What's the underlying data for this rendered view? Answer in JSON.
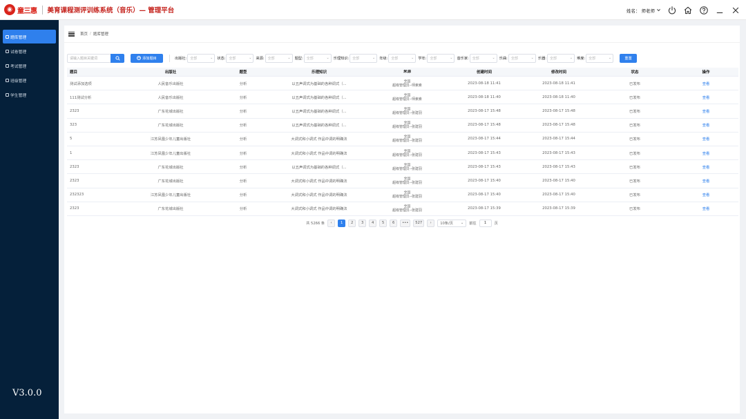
{
  "header": {
    "logo_text": "童三惠",
    "title": "美育课程测评训练系统（音乐）— 管理平台",
    "user_label": "姓名：",
    "user_name": "师老师",
    "icons": [
      "power-icon",
      "home-icon",
      "help-icon",
      "minimize-icon",
      "close-icon"
    ]
  },
  "sidebar": {
    "items": [
      {
        "label": "题库管理",
        "active": true
      },
      {
        "label": "试卷管理",
        "active": false
      },
      {
        "label": "考试管理",
        "active": false
      },
      {
        "label": "班级管理",
        "active": false
      },
      {
        "label": "学生管理",
        "active": false
      }
    ],
    "version": "V3.0.0"
  },
  "breadcrumb": {
    "home": "首页",
    "sep": "/",
    "current": "题库管理"
  },
  "toolbar": {
    "search_placeholder": "请输入题目关键词",
    "add_label": "添加题目",
    "reset_label": "重置",
    "filters": [
      {
        "label": "出版社:",
        "value": "全部"
      },
      {
        "label": "状态:",
        "value": "全部"
      },
      {
        "label": "来源:",
        "value": "全部"
      },
      {
        "label": "题型:",
        "value": "全部"
      },
      {
        "label": "乐理知识:",
        "value": "全部"
      },
      {
        "label": "年级:",
        "value": "全部"
      },
      {
        "label": "学年:",
        "value": "全部"
      },
      {
        "label": "音乐家:",
        "value": "全部"
      },
      {
        "label": "乐曲:",
        "value": "全部"
      },
      {
        "label": "乐器:",
        "value": "全部"
      },
      {
        "label": "难度:",
        "value": "全部"
      }
    ]
  },
  "table": {
    "headers": [
      "题目",
      "出版社",
      "题型",
      "乐理知识",
      "来源",
      "创建时间",
      "修改时间",
      "状态",
      "操作"
    ],
    "rows": [
      {
        "title": "测试添加选项",
        "publisher": "人民音乐出版社",
        "type": "分析",
        "knowledge": "以五声调式为基础的各种调式（...",
        "source1": "全国",
        "source2": "超级管理员--师索索",
        "created": "2023-08-18 11:41",
        "modified": "2023-08-18 11:41",
        "status": "已发布",
        "action": "查看"
      },
      {
        "title": "111测试分析",
        "publisher": "人民音乐出版社",
        "type": "分析",
        "knowledge": "以五声调式为基础的各种调式（...",
        "source1": "全国",
        "source2": "超级管理员--师索索",
        "created": "2023-08-18 11:40",
        "modified": "2023-08-18 11:40",
        "status": "已发布",
        "action": "查看"
      },
      {
        "title": "2323",
        "publisher": "广东花城出版社",
        "type": "分析",
        "knowledge": "以五声调式为基础的各种调式（...",
        "source1": "全国",
        "source2": "超级管理员--张建羽",
        "created": "2023-08-17 15:48",
        "modified": "2023-08-17 15:48",
        "status": "已发布",
        "action": "查看"
      },
      {
        "title": "323",
        "publisher": "广东花城出版社",
        "type": "分析",
        "knowledge": "以五声调式为基础的各种调式（...",
        "source1": "全国",
        "source2": "超级管理员--张建羽",
        "created": "2023-08-17 15:48",
        "modified": "2023-08-17 15:48",
        "status": "已发布",
        "action": "查看"
      },
      {
        "title": "5",
        "publisher": "江苏凤凰少年儿童出版社",
        "type": "分析",
        "knowledge": "大调式和小调式 作品中调的明确法",
        "source1": "全国",
        "source2": "超级管理员--张建羽",
        "created": "2023-08-17 15:44",
        "modified": "2023-08-17 15:44",
        "status": "已发布",
        "action": "查看"
      },
      {
        "title": "1",
        "publisher": "江苏凤凰少年儿童出版社",
        "type": "分析",
        "knowledge": "大调式和小调式 作品中调的明确法",
        "source1": "全国",
        "source2": "超级管理员--张建羽",
        "created": "2023-08-17 15:43",
        "modified": "2023-08-17 15:43",
        "status": "已发布",
        "action": "查看"
      },
      {
        "title": "2323",
        "publisher": "广东花城出版社",
        "type": "分析",
        "knowledge": "以五声调式为基础的各种调式（...",
        "source1": "全国",
        "source2": "超级管理员--张建羽",
        "created": "2023-08-17 15:43",
        "modified": "2023-08-17 15:43",
        "status": "已发布",
        "action": "查看"
      },
      {
        "title": "2323",
        "publisher": "广东花城出版社",
        "type": "分析",
        "knowledge": "大调式和小调式 作品中调的明确法",
        "source1": "全国",
        "source2": "超级管理员--张建羽",
        "created": "2023-08-17 15:40",
        "modified": "2023-08-17 15:40",
        "status": "已发布",
        "action": "查看"
      },
      {
        "title": "232323",
        "publisher": "江苏凤凰少年儿童出版社",
        "type": "分析",
        "knowledge": "大调式和小调式 作品中调的明确法",
        "source1": "全国",
        "source2": "超级管理员--张建羽",
        "created": "2023-08-17 15:40",
        "modified": "2023-08-17 15:40",
        "status": "已发布",
        "action": "查看"
      },
      {
        "title": "2323",
        "publisher": "广东花城出版社",
        "type": "分析",
        "knowledge": "大调式和小调式 作品中调的明确法",
        "source1": "全国",
        "source2": "超级管理员--张建羽",
        "created": "2023-08-17 15:39",
        "modified": "2023-08-17 15:39",
        "status": "已发布",
        "action": "查看"
      }
    ]
  },
  "pagination": {
    "total_text": "共 5266 条",
    "pages": [
      "1",
      "2",
      "3",
      "4",
      "5",
      "6",
      "•••",
      "527"
    ],
    "current_page": "1",
    "page_size": "10条/页",
    "goto_label": "前往",
    "goto_value": "1",
    "goto_suffix": "页"
  },
  "colors": {
    "accent": "#2f80ed",
    "sidebar": "#05203a",
    "brand": "#d9241b"
  }
}
